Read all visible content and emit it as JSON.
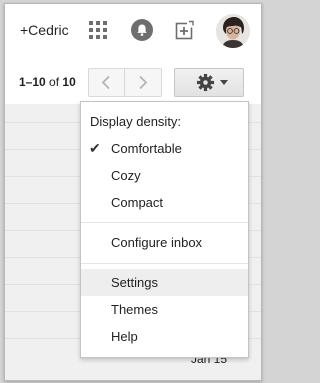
{
  "header": {
    "profile_link": "+Cedric",
    "icons": [
      "apps-grid-icon",
      "notifications-bell-icon",
      "share-plus-icon",
      "avatar"
    ]
  },
  "toolbar": {
    "range_start_end": "1–10",
    "of_label": " of ",
    "total": "10",
    "prev_icon": "chevron-left-icon",
    "next_icon": "chevron-right-icon",
    "settings_icon": "gear-icon"
  },
  "menu": {
    "density_heading": "Display density:",
    "density_options": [
      {
        "label": "Comfortable",
        "selected": true
      },
      {
        "label": "Cozy",
        "selected": false
      },
      {
        "label": "Compact",
        "selected": false
      }
    ],
    "configure_inbox": "Configure inbox",
    "settings": "Settings",
    "themes": "Themes",
    "help": "Help"
  },
  "list": {
    "last_date": "Jan 15"
  },
  "colors": {
    "accent_gray": "#6e6e6e",
    "menu_hover": "#eeeeee",
    "list_bg": "#f0f0f0"
  }
}
